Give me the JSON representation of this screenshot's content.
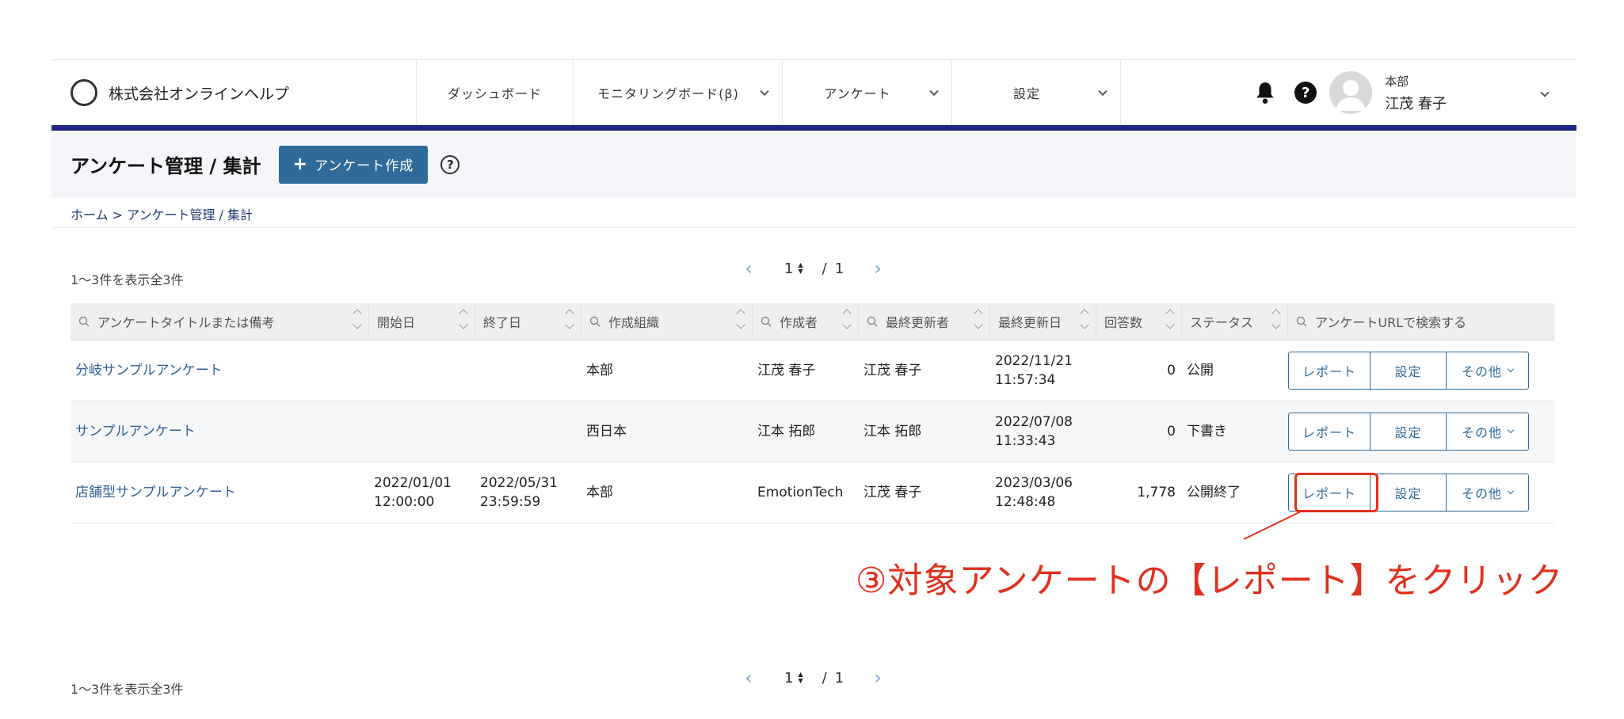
{
  "header": {
    "brand": "株式会社オンラインヘルプ",
    "nav": [
      {
        "label": "ダッシュボード",
        "dropdown": false
      },
      {
        "label": "モニタリングボード(β)",
        "dropdown": true
      },
      {
        "label": "アンケート",
        "dropdown": true
      },
      {
        "label": "設定",
        "dropdown": true
      }
    ],
    "user": {
      "org": "本部",
      "name": "江茂 春子"
    },
    "help_glyph": "?"
  },
  "titlebar": {
    "title": "アンケート管理 / 集計",
    "create_label": "アンケート作成",
    "help_glyph": "?"
  },
  "breadcrumb": "ホーム > アンケート管理 / 集計",
  "summary": {
    "count_text": "1〜3件を表示全3件",
    "page": "1",
    "page_sep": "/",
    "total_pages": "1"
  },
  "table": {
    "columns": [
      {
        "label": "アンケートタイトルまたは備考",
        "search": true
      },
      {
        "label": "開始日",
        "search": false
      },
      {
        "label": "終了日",
        "search": false
      },
      {
        "label": "作成組織",
        "search": true
      },
      {
        "label": "作成者",
        "search": true
      },
      {
        "label": "最終更新者",
        "search": true
      },
      {
        "label": "最終更新日",
        "search": false
      },
      {
        "label": "回答数",
        "search": false
      },
      {
        "label": "ステータス",
        "search": false
      },
      {
        "label": "アンケートURLで検索する",
        "search": true
      }
    ],
    "rows": [
      {
        "title": "分岐サンプルアンケート",
        "start": [
          "",
          ""
        ],
        "end": [
          "",
          ""
        ],
        "org": "本部",
        "creator": "江茂 春子",
        "updater": "江茂 春子",
        "updated": [
          "2022/11/21",
          "11:57:34"
        ],
        "responses": "0",
        "status": "公開"
      },
      {
        "title": "サンプルアンケート",
        "start": [
          "",
          ""
        ],
        "end": [
          "",
          ""
        ],
        "org": "西日本",
        "creator": "江本 拓郎",
        "updater": "江本 拓郎",
        "updated": [
          "2022/07/08",
          "11:33:43"
        ],
        "responses": "0",
        "status": "下書き"
      },
      {
        "title": "店舗型サンプルアンケート",
        "start": [
          "2022/01/01",
          "12:00:00"
        ],
        "end": [
          "2022/05/31",
          "23:59:59"
        ],
        "org": "本部",
        "creator": "EmotionTech",
        "updater": "江茂 春子",
        "updated": [
          "2023/03/06",
          "12:48:48"
        ],
        "responses": "1,778",
        "status": "公開終了"
      }
    ],
    "actions": {
      "report": "レポート",
      "settings": "設定",
      "other": "その他"
    }
  },
  "annotation": {
    "text": "③対象アンケートの【レポート】をクリック",
    "color": "#e0301e"
  },
  "colors": {
    "accent": "#2f6b9a",
    "nav_border": "#1f2781",
    "link": "#2c5f96"
  }
}
